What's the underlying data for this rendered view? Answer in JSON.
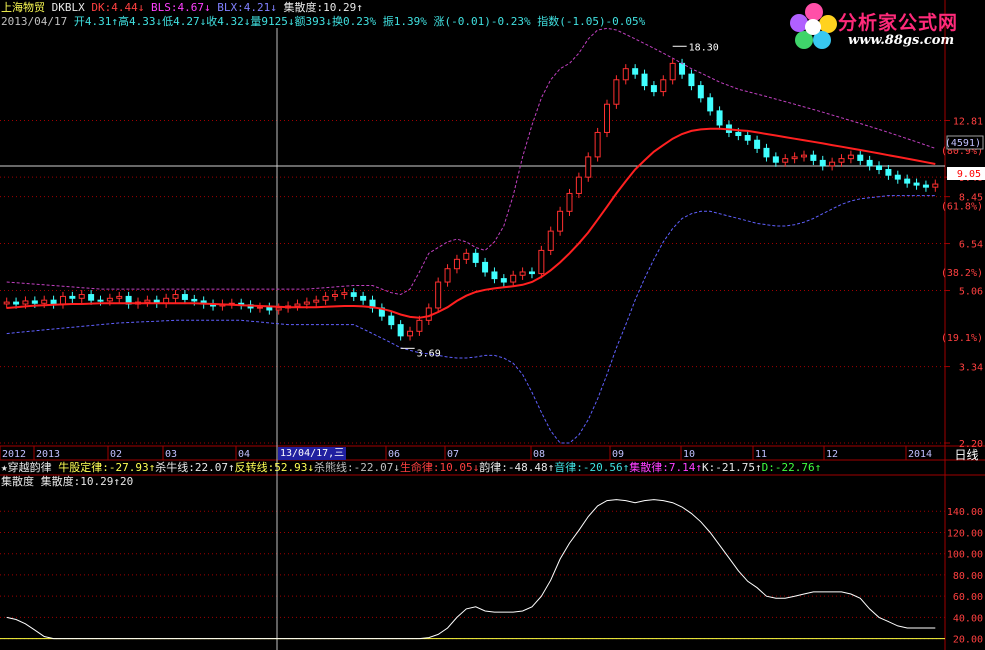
{
  "header": {
    "stock_name": "上海物贸",
    "indicator_name": "DKBLX",
    "dk": "DK:4.44↓",
    "bls": "BLS:4.67↓",
    "blx": "BLX:4.21↓",
    "jsd": "集散度:10.29↑",
    "date": "2013/04/17",
    "open": "开4.31↑",
    "high": "高4.33↓",
    "low": "低4.27↓",
    "close": "收4.32↓",
    "volume": "量9125↓",
    "amount": "额393↓",
    "turnover": "换0.23%",
    "amplitude": "振1.39%",
    "change": "涨(-0.01)-0.23%",
    "index": "指数(-1.05)-0.05%"
  },
  "logo": {
    "title": "分析家公式网",
    "url": "www.88gs.com"
  },
  "indicator": {
    "title": "★穿越韵律",
    "bull": "牛股定律:-27.93↑",
    "kill_bull": "杀牛线:22.07↑",
    "reverse": "反转线:52.93↓",
    "kill_bear": "杀熊线:-22.07↓",
    "life": "生命律:10.05↓",
    "rhythm": "韵律:-48.48↑",
    "sound": "音律:-20.56↑",
    "jsl": "集散律:7.14↑",
    "k": "K:-21.75↑",
    "d": "D:-22.76↑"
  },
  "sub_indicator": {
    "title": "集散度",
    "value": "集散度:10.29↑20"
  },
  "period_button": "日线",
  "cursor_date": "13/04/17,三",
  "colors": {
    "up": "#ff3030",
    "down": "#40ffff",
    "ma": "#ff2020",
    "band": "#c040c0",
    "band_low": "#6060ff",
    "grid": "#a00000",
    "axis": "#a00000"
  },
  "chart_data": [
    {
      "type": "candlestick",
      "title": "上海物贸",
      "x_labels": [
        "2012",
        "2013",
        "02",
        "03",
        "04",
        "13/04/17,三",
        "06",
        "07",
        "08",
        "09",
        "10",
        "11",
        "12",
        "2014"
      ],
      "y_ticks": [
        "12.81",
        "9.40",
        "8.45",
        "6.54",
        "5.06",
        "3.34",
        "2.20"
      ],
      "y_pct_labels": [
        "(80.9%)",
        "(61.8%)",
        "(38.2%)",
        "(19.1%)"
      ],
      "y_axis_tags": [
        "(4591)",
        "9.05"
      ],
      "ylim": [
        2.2,
        21
      ],
      "scale": "log",
      "annotations": [
        {
          "label": "18.30",
          "value": 18.3
        },
        {
          "label": "3.69",
          "value": 3.69
        }
      ],
      "series": [
        {
          "name": "price",
          "values": [
            4.75,
            4.7,
            4.78,
            4.72,
            4.8,
            4.7,
            4.9,
            4.85,
            4.95,
            4.8,
            4.78,
            4.85,
            4.9,
            4.7,
            4.75,
            4.8,
            4.72,
            4.85,
            4.95,
            4.82,
            4.78,
            4.7,
            4.65,
            4.7,
            4.72,
            4.68,
            4.6,
            4.62,
            4.55,
            4.6,
            4.65,
            4.7,
            4.75,
            4.8,
            4.9,
            4.95,
            5.0,
            4.9,
            4.8,
            4.6,
            4.4,
            4.2,
            3.95,
            4.05,
            4.3,
            4.6,
            5.3,
            5.7,
            6.0,
            6.2,
            5.9,
            5.6,
            5.4,
            5.3,
            5.5,
            5.6,
            5.55,
            6.3,
            7.0,
            7.8,
            8.6,
            9.4,
            10.5,
            12.0,
            14.0,
            16.0,
            17.0,
            16.5,
            15.5,
            15.0,
            16.0,
            17.5,
            16.5,
            15.5,
            14.5,
            13.5,
            12.5,
            12.0,
            11.8,
            11.5,
            11.0,
            10.5,
            10.2,
            10.4,
            10.5,
            10.6,
            10.3,
            10.0,
            10.2,
            10.4,
            10.6,
            10.3,
            10.0,
            9.8,
            9.5,
            9.3,
            9.1,
            9.0,
            8.9,
            9.05
          ]
        },
        {
          "name": "DK",
          "values": [
            4.6,
            4.62,
            4.64,
            4.66,
            4.67,
            4.68,
            4.69,
            4.7,
            4.7,
            4.71,
            4.72,
            4.72,
            4.72,
            4.72,
            4.72,
            4.72,
            4.72,
            4.72,
            4.72,
            4.72,
            4.72,
            4.71,
            4.7,
            4.69,
            4.68,
            4.67,
            4.66,
            4.65,
            4.64,
            4.63,
            4.62,
            4.62,
            4.62,
            4.62,
            4.63,
            4.64,
            4.65,
            4.65,
            4.64,
            4.62,
            4.58,
            4.52,
            4.44,
            4.38,
            4.36,
            4.4,
            4.5,
            4.62,
            4.78,
            4.92,
            5.02,
            5.08,
            5.12,
            5.15,
            5.18,
            5.22,
            5.3,
            5.45,
            5.65,
            5.9,
            6.2,
            6.55,
            6.95,
            7.45,
            8.0,
            8.6,
            9.2,
            9.8,
            10.3,
            10.8,
            11.2,
            11.6,
            11.9,
            12.1,
            12.2,
            12.25,
            12.25,
            12.2,
            12.15,
            12.1,
            12.0,
            11.9,
            11.8,
            11.7,
            11.6,
            11.5,
            11.4,
            11.3,
            11.2,
            11.1,
            11.0,
            10.9,
            10.8,
            10.7,
            10.6,
            10.5,
            10.4,
            10.3,
            10.2,
            10.1
          ]
        },
        {
          "name": "BLS",
          "values": [
            5.3,
            5.28,
            5.26,
            5.24,
            5.22,
            5.2,
            5.18,
            5.16,
            5.14,
            5.12,
            5.1,
            5.1,
            5.1,
            5.1,
            5.1,
            5.1,
            5.1,
            5.1,
            5.1,
            5.1,
            5.1,
            5.1,
            5.1,
            5.1,
            5.1,
            5.1,
            5.1,
            5.1,
            5.1,
            5.1,
            5.1,
            5.1,
            5.1,
            5.12,
            5.14,
            5.16,
            5.18,
            5.2,
            5.2,
            5.2,
            5.1,
            5.0,
            4.95,
            5.1,
            5.6,
            6.2,
            6.4,
            6.6,
            6.7,
            6.6,
            6.4,
            6.3,
            6.6,
            7.2,
            8.5,
            10.5,
            12.5,
            14.5,
            16.0,
            17.0,
            17.5,
            18.5,
            20.0,
            21.0,
            21.2,
            21.0,
            20.5,
            20.0,
            19.5,
            19.0,
            18.5,
            18.0,
            17.5,
            17.0,
            16.6,
            16.2,
            15.8,
            15.5,
            15.2,
            15.0,
            14.8,
            14.6,
            14.4,
            14.2,
            14.0,
            13.8,
            13.6,
            13.4,
            13.2,
            13.0,
            12.8,
            12.6,
            12.4,
            12.2,
            12.0,
            11.8,
            11.6,
            11.4,
            11.2,
            11.0
          ]
        },
        {
          "name": "BLX",
          "values": [
            4.0,
            4.02,
            4.04,
            4.06,
            4.08,
            4.1,
            4.12,
            4.14,
            4.16,
            4.18,
            4.2,
            4.22,
            4.24,
            4.25,
            4.26,
            4.27,
            4.28,
            4.29,
            4.3,
            4.3,
            4.3,
            4.3,
            4.3,
            4.3,
            4.3,
            4.3,
            4.28,
            4.26,
            4.24,
            4.22,
            4.2,
            4.2,
            4.2,
            4.2,
            4.2,
            4.2,
            4.2,
            4.2,
            4.1,
            4.0,
            3.9,
            3.8,
            3.7,
            3.65,
            3.6,
            3.58,
            3.55,
            3.52,
            3.5,
            3.5,
            3.52,
            3.55,
            3.55,
            3.5,
            3.4,
            3.2,
            2.9,
            2.6,
            2.35,
            2.2,
            2.2,
            2.3,
            2.5,
            2.8,
            3.2,
            3.7,
            4.2,
            4.8,
            5.4,
            6.0,
            6.6,
            7.1,
            7.5,
            7.7,
            7.8,
            7.8,
            7.7,
            7.6,
            7.5,
            7.4,
            7.3,
            7.25,
            7.2,
            7.2,
            7.25,
            7.35,
            7.5,
            7.7,
            7.9,
            8.1,
            8.25,
            8.35,
            8.4,
            8.45,
            8.5,
            8.5,
            8.5,
            8.5,
            8.5,
            8.5
          ]
        }
      ]
    },
    {
      "type": "line",
      "title": "集散度",
      "y_ticks": [
        "140.00",
        "120.00",
        "100.00",
        "80.00",
        "60.00",
        "40.00",
        "20.00"
      ],
      "ylim": [
        14,
        160
      ],
      "series": [
        {
          "name": "集散度",
          "values": [
            40,
            38,
            34,
            28,
            22,
            20,
            20,
            20,
            20,
            20,
            20,
            20,
            20,
            20,
            20,
            20,
            20,
            20,
            20,
            20,
            20,
            20,
            20,
            20,
            20,
            20,
            20,
            20,
            20,
            20,
            20,
            20,
            20,
            20,
            20,
            20,
            20,
            20,
            20,
            20,
            20,
            20,
            20,
            20,
            20,
            21,
            24,
            30,
            40,
            48,
            50,
            46,
            45,
            45,
            45,
            46,
            50,
            60,
            75,
            95,
            110,
            122,
            135,
            145,
            150,
            151,
            150,
            148,
            150,
            151,
            150,
            148,
            144,
            138,
            130,
            120,
            108,
            96,
            84,
            74,
            68,
            60,
            58,
            58,
            60,
            62,
            64,
            64,
            64,
            64,
            62,
            58,
            48,
            40,
            36,
            32,
            30,
            30,
            30,
            30
          ]
        }
      ]
    }
  ]
}
